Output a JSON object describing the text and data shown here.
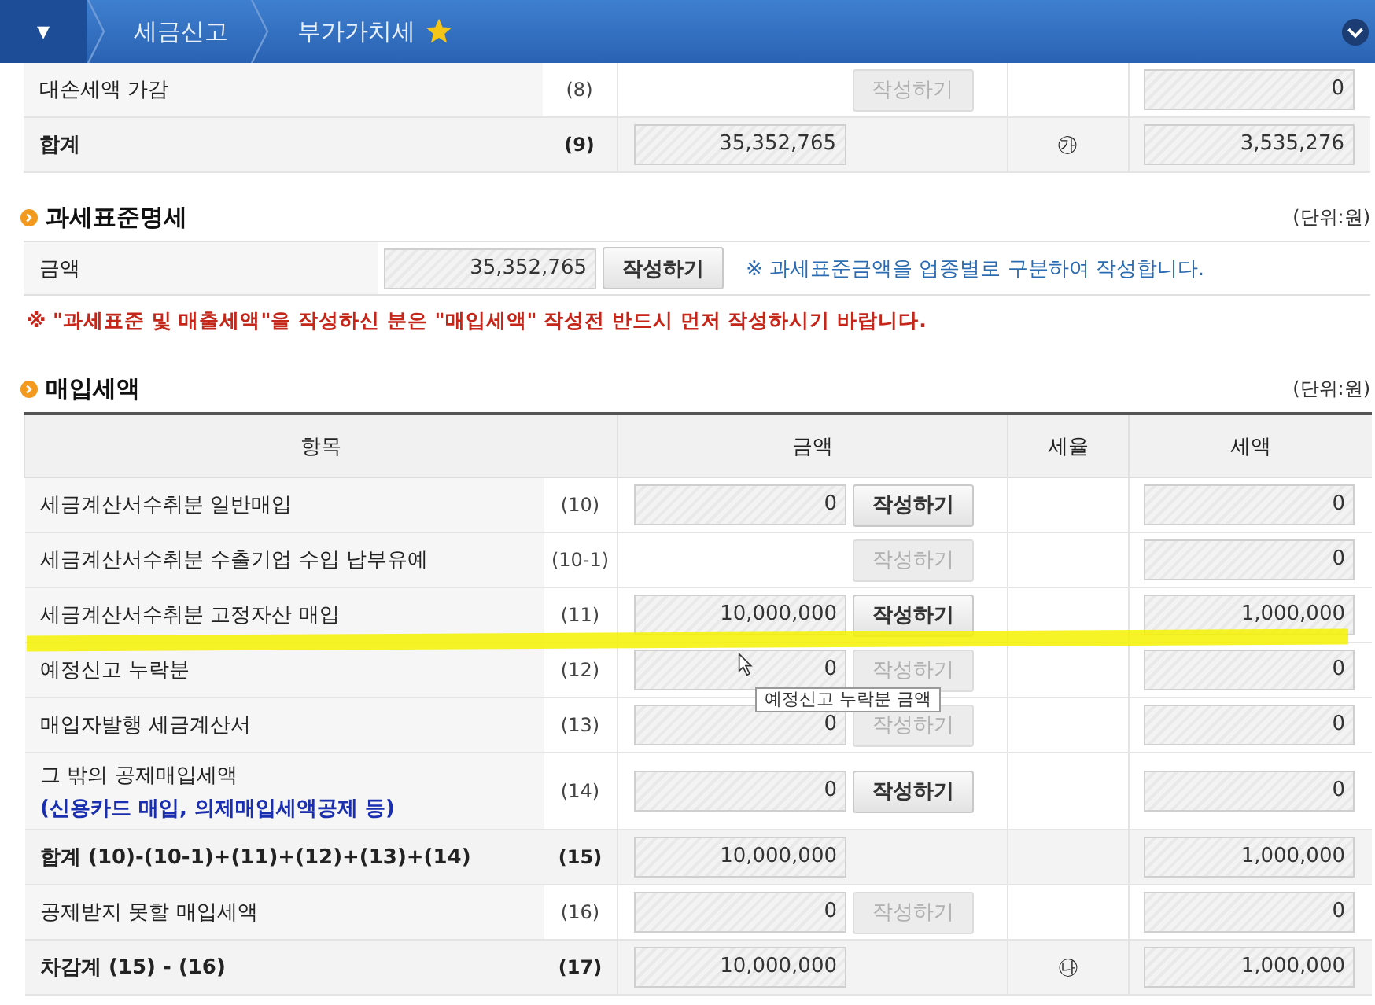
{
  "breadcrumb": {
    "menu_glyph": "▾",
    "items": [
      {
        "label": "세금신고",
        "starred": false
      },
      {
        "label": "부가가치세",
        "starred": true
      }
    ]
  },
  "top_rows": [
    {
      "label": "대손세액 가감",
      "no": "(8)",
      "kind": "normal",
      "amount": null,
      "button": {
        "label": "작성하기",
        "disabled": true
      },
      "mark": null,
      "tax": "0"
    },
    {
      "label": "합계",
      "no": "(9)",
      "kind": "total",
      "amount": "35,352,765",
      "button": null,
      "mark": "㉮",
      "tax": "3,535,276"
    }
  ],
  "tax_base": {
    "title": "과세표준명세",
    "unit": "(단위:원)",
    "label": "금액",
    "amount": "35,352,765",
    "button": {
      "label": "작성하기",
      "disabled": false
    },
    "note": "※ 과세표준금액을 업종별로 구분하여 작성합니다."
  },
  "warning": "※ \"과세표준 및 매출세액\"을 작성하신 분은 \"매입세액\" 작성전 반드시 먼저 작성하시기 바랍니다.",
  "purchase": {
    "title": "매입세액",
    "unit": "(단위:원)",
    "columns": [
      "항목",
      "금액",
      "세율",
      "세액"
    ],
    "rows": [
      {
        "label": "세금계산서수취분 일반매입",
        "no": "(10)",
        "kind": "normal",
        "amount": "0",
        "button": {
          "label": "작성하기",
          "disabled": false
        },
        "mark": null,
        "tax": "0"
      },
      {
        "label": "세금계산서수취분 수출기업 수입 납부유예",
        "no": "(10-1)",
        "kind": "normal",
        "amount": null,
        "button": {
          "label": "작성하기",
          "disabled": true
        },
        "mark": null,
        "tax": "0"
      },
      {
        "label": "세금계산서수취분 고정자산 매입",
        "no": "(11)",
        "kind": "normal",
        "amount": "10,000,000",
        "button": {
          "label": "작성하기",
          "disabled": false
        },
        "mark": null,
        "tax": "1,000,000"
      },
      {
        "label": "예정신고 누락분",
        "no": "(12)",
        "kind": "normal",
        "amount": "0",
        "button": {
          "label": "작성하기",
          "disabled": true
        },
        "mark": null,
        "tax": "0"
      },
      {
        "label": "매입자발행 세금계산서",
        "no": "(13)",
        "kind": "normal",
        "amount": "0",
        "button": {
          "label": "작성하기",
          "disabled": true
        },
        "mark": null,
        "tax": "0"
      },
      {
        "label": "그 밖의 공제매입세액",
        "sublabel": "(신용카드 매입, 의제매입세액공제 등)",
        "no": "(14)",
        "kind": "normal",
        "amount": "0",
        "button": {
          "label": "작성하기",
          "disabled": false
        },
        "mark": null,
        "tax": "0"
      },
      {
        "label": "합계 (10)-(10-1)+(11)+(12)+(13)+(14)",
        "no": "(15)",
        "kind": "total",
        "amount": "10,000,000",
        "button": null,
        "mark": null,
        "tax": "1,000,000"
      },
      {
        "label": "공제받지 못할 매입세액",
        "no": "(16)",
        "kind": "normal",
        "amount": "0",
        "button": {
          "label": "작성하기",
          "disabled": true
        },
        "mark": null,
        "tax": "0"
      },
      {
        "label": "차감계 (15) - (16)",
        "no": "(17)",
        "kind": "total",
        "amount": "10,000,000",
        "button": null,
        "mark": "㉯",
        "tax": "1,000,000"
      }
    ]
  },
  "tooltip": {
    "text": "예정신고 누락분 금액"
  }
}
